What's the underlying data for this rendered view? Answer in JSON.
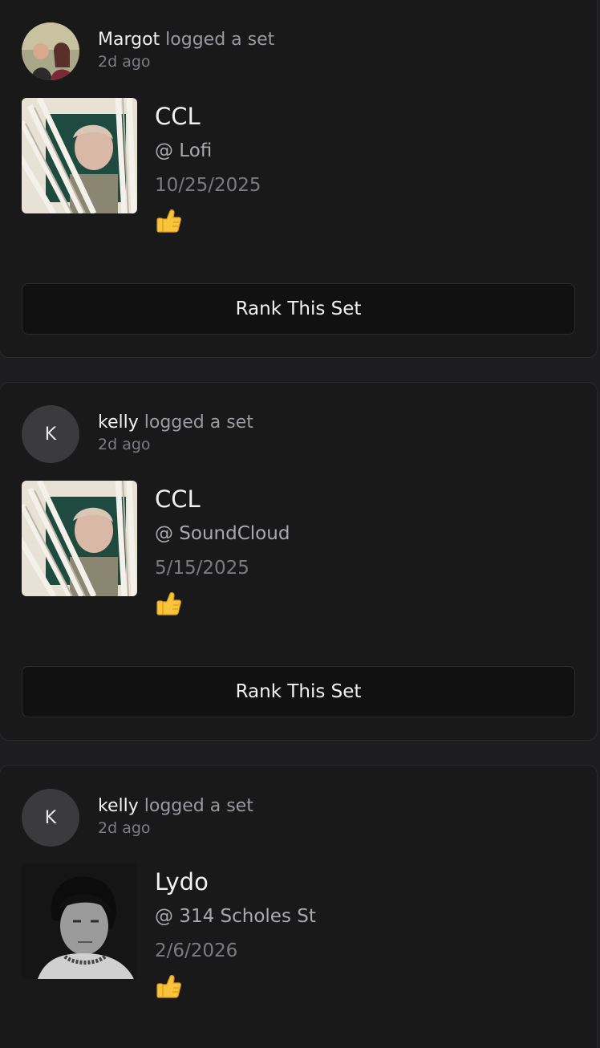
{
  "feed": {
    "action_text": "logged a set",
    "rank_button_label": "Rank This Set",
    "reaction_icon": "thumbs-up",
    "posts": [
      {
        "user": "Margot",
        "avatar_initial": "",
        "time": "2d ago",
        "title": "CCL",
        "venue": "@ Lofi",
        "date": "10/25/2025"
      },
      {
        "user": "kelly",
        "avatar_initial": "K",
        "time": "2d ago",
        "title": "CCL",
        "venue": "@ SoundCloud",
        "date": "5/15/2025"
      },
      {
        "user": "kelly",
        "avatar_initial": "K",
        "time": "2d ago",
        "title": "Lydo",
        "venue": "@ 314 Scholes St",
        "date": "2/6/2026"
      }
    ]
  },
  "colors": {
    "page_bg": "#1d1d20",
    "card_bg": "#19191a",
    "button_bg": "#111112",
    "text_primary": "#f1f1f3",
    "text_muted": "#9a9aa0",
    "avatar_bg": "#3b3b3e",
    "thumb_yellow": "#f7c43c"
  }
}
